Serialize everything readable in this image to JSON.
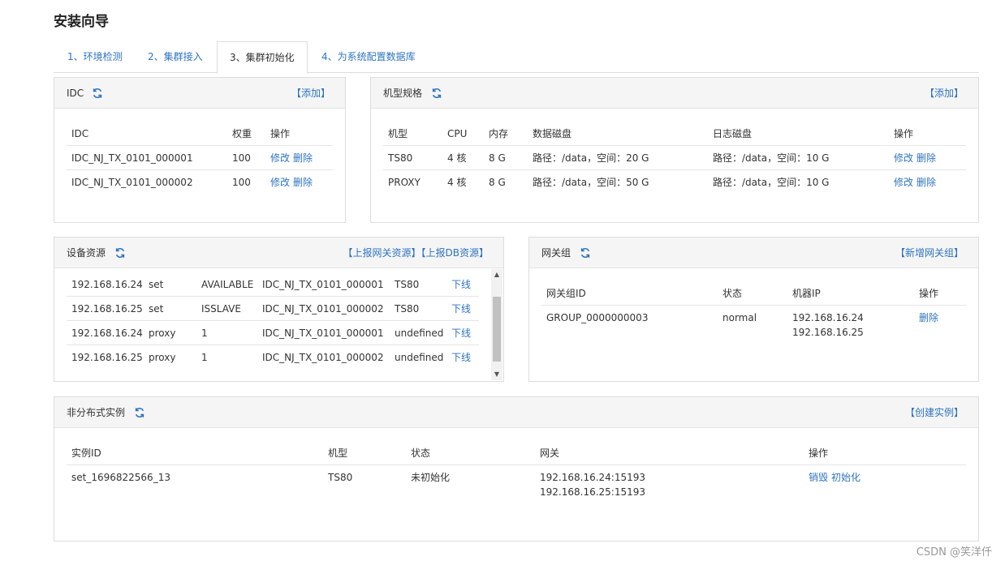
{
  "page": {
    "title": "安装向导"
  },
  "tabs": [
    {
      "label": "1、环境检测"
    },
    {
      "label": "2、集群接入"
    },
    {
      "label": "3、集群初始化"
    },
    {
      "label": "4、为系统配置数据库"
    }
  ],
  "active_tab": 2,
  "icons": {
    "refresh": "refresh-icon",
    "accent": "#2e74c0"
  },
  "idc": {
    "title": "IDC",
    "add": "【添加】",
    "headers": [
      "IDC",
      "权重",
      "操作"
    ],
    "rows": [
      {
        "name": "IDC_NJ_TX_0101_000001",
        "weight": "100",
        "edit": "修改",
        "delete": "删除"
      },
      {
        "name": "IDC_NJ_TX_0101_000002",
        "weight": "100",
        "edit": "修改",
        "delete": "删除"
      }
    ]
  },
  "spec": {
    "title": "机型规格",
    "add": "【添加】",
    "headers": [
      "机型",
      "CPU",
      "内存",
      "数据磁盘",
      "日志磁盘",
      "操作"
    ],
    "rows": [
      {
        "model": "TS80",
        "cpu": "4 核",
        "mem": "8 G",
        "data": "路径：/data，空间：20 G",
        "log": "路径：/data，空间：10 G",
        "edit": "修改",
        "delete": "删除"
      },
      {
        "model": "PROXY",
        "cpu": "4 核",
        "mem": "8 G",
        "data": "路径：/data，空间：50 G",
        "log": "路径：/data，空间：10 G",
        "edit": "修改",
        "delete": "删除"
      }
    ]
  },
  "device": {
    "title": "设备资源",
    "report_gw": "【上报网关资源】",
    "report_db": "【上报DB资源】",
    "rows": [
      {
        "ip": "192.168.16.24",
        "type": "set",
        "state": "AVAILABLE",
        "idc": "IDC_NJ_TX_0101_000001",
        "model": "TS80",
        "action": "下线"
      },
      {
        "ip": "192.168.16.25",
        "type": "set",
        "state": "ISSLAVE",
        "idc": "IDC_NJ_TX_0101_000002",
        "model": "TS80",
        "action": "下线"
      },
      {
        "ip": "192.168.16.24",
        "type": "proxy",
        "state": "1",
        "idc": "IDC_NJ_TX_0101_000001",
        "model": "undefined",
        "action": "下线"
      },
      {
        "ip": "192.168.16.25",
        "type": "proxy",
        "state": "1",
        "idc": "IDC_NJ_TX_0101_000002",
        "model": "undefined",
        "action": "下线"
      }
    ]
  },
  "gateway": {
    "title": "网关组",
    "add": "【新增网关组】",
    "headers": [
      "网关组ID",
      "状态",
      "机器IP",
      "操作"
    ],
    "rows": [
      {
        "id": "GROUP_0000000003",
        "status": "normal",
        "ip1": "192.168.16.24",
        "ip2": "192.168.16.25",
        "delete": "删除"
      }
    ]
  },
  "instances": {
    "title": "非分布式实例",
    "create": "【创建实例】",
    "headers": [
      "实例ID",
      "机型",
      "状态",
      "网关",
      "操作"
    ],
    "rows": [
      {
        "id": "set_1696822566_13",
        "model": "TS80",
        "status": "未初始化",
        "gw1": "192.168.16.24:15193",
        "gw2": "192.168.16.25:15193",
        "destroy": "销毁",
        "init": "初始化"
      }
    ]
  },
  "watermark": "CSDN @笑洋仟"
}
